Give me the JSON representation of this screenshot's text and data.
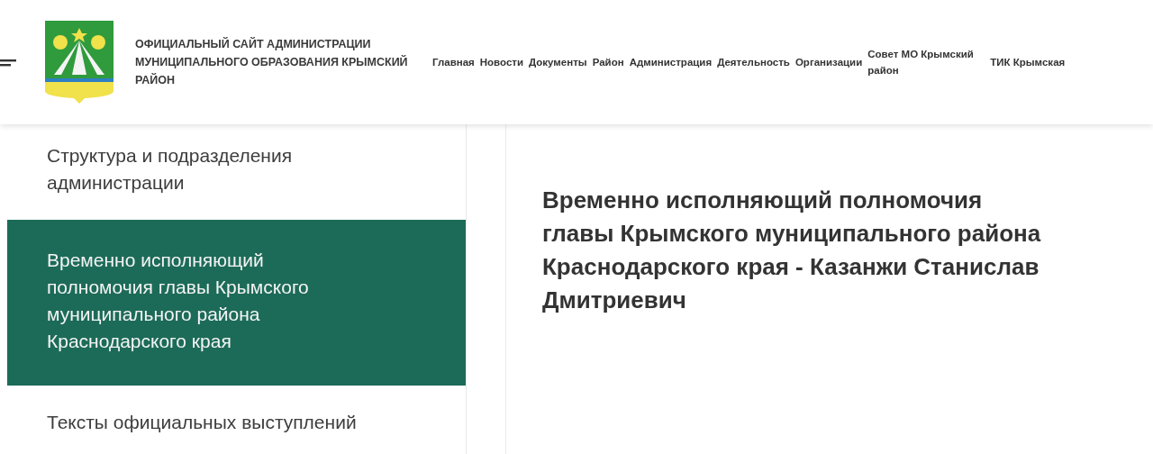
{
  "header": {
    "site_title": "ОФИЦИАЛЬНЫЙ САЙТ АДМИНИСТРАЦИИ МУНИЦИПАЛЬНОГО ОБРАЗОВАНИЯ КРЫМСКИЙ РАЙОН",
    "nav": [
      {
        "label": "Главная"
      },
      {
        "label": "Новости"
      },
      {
        "label": "Документы"
      },
      {
        "label": "Район"
      },
      {
        "label": "Администрация"
      },
      {
        "label": "Деятельность"
      },
      {
        "label": "Организации"
      },
      {
        "label": "Совет МО Крымский район"
      },
      {
        "label": "ТИК Крымская"
      }
    ]
  },
  "sidebar": {
    "items": [
      {
        "label": "Структура и подразделения администрации",
        "selected": false
      },
      {
        "label": "Временно исполняющий полномочия главы Крымского муниципального района Краснодарского края",
        "selected": true
      },
      {
        "label": "Тексты официальных выступлений",
        "selected": false
      }
    ]
  },
  "content": {
    "heading": "Временно исполняющий полномочия главы Крымского муниципального района Краснодарского края - Казанжи Станислав Дмитриевич"
  }
}
